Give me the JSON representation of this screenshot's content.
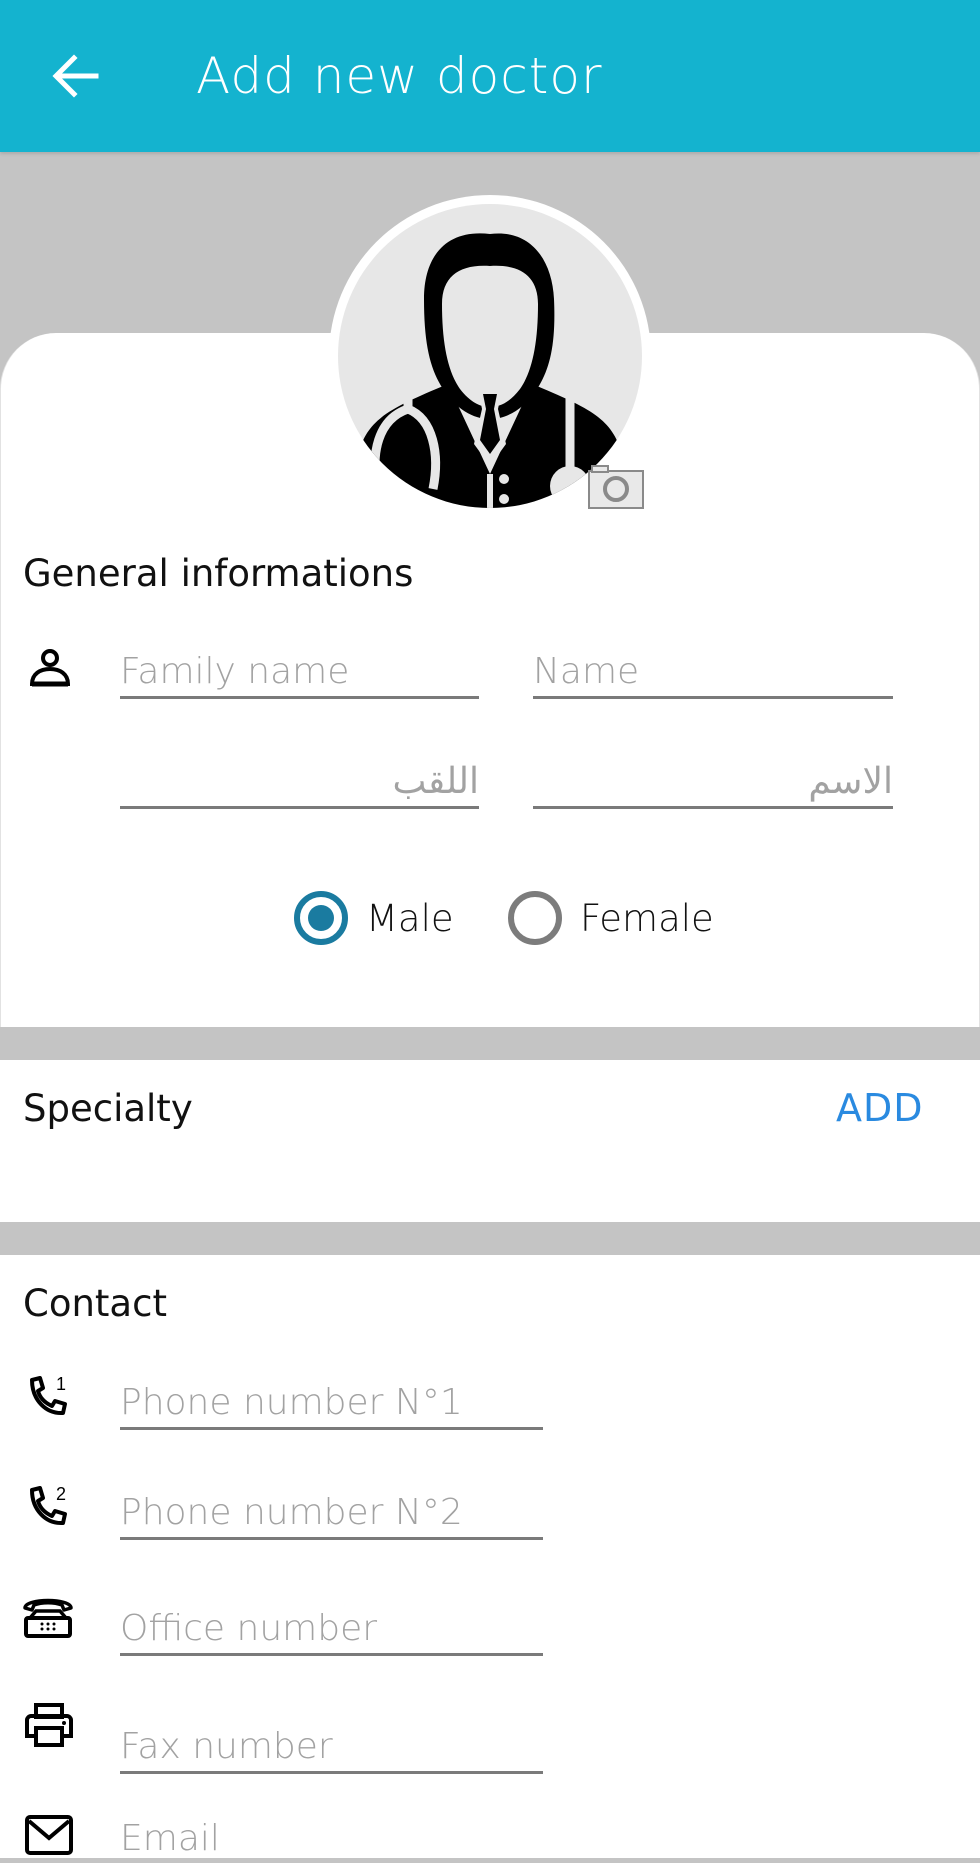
{
  "appbar": {
    "back_icon": "arrow-left-icon",
    "title": "Add new doctor",
    "background_color": "#14b3cf"
  },
  "avatar": {
    "icon": "doctor-avatar-icon",
    "camera_icon": "camera-icon"
  },
  "general": {
    "title": "General informations",
    "person_icon": "person-icon",
    "family_name_placeholder": "Family name",
    "name_placeholder": "Name",
    "family_name_ar_placeholder": "اللقب",
    "name_ar_placeholder": "الاسم",
    "gender": {
      "options": [
        "Male",
        "Female"
      ],
      "selected": "Male",
      "accent_color": "#1a7ba0"
    }
  },
  "specialty": {
    "title": "Specialty",
    "add_label": "ADD",
    "add_color": "#2a8ae0"
  },
  "contact": {
    "title": "Contact",
    "fields": [
      {
        "icon": "phone-1-icon",
        "placeholder": "Phone number N°1",
        "badge": "1"
      },
      {
        "icon": "phone-2-icon",
        "placeholder": "Phone number N°2",
        "badge": "2"
      },
      {
        "icon": "office-phone-icon",
        "placeholder": "Office number"
      },
      {
        "icon": "fax-printer-icon",
        "placeholder": "Fax number"
      },
      {
        "icon": "email-icon",
        "placeholder": "Email"
      }
    ]
  }
}
